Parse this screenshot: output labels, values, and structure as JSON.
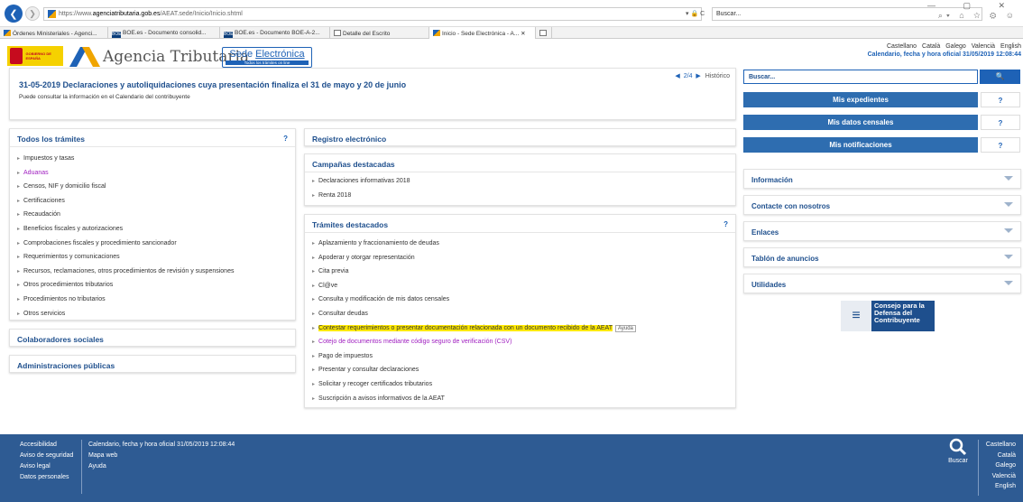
{
  "browser": {
    "url_scheme": "https://www.",
    "url_host": "agenciatributaria.gob.es",
    "url_path": "/AEAT.sede/Inicio/Inicio.shtml",
    "url_tools": "▾ 🔒 C",
    "search_placeholder": "Buscar...",
    "window_controls": "— ▢ ✕",
    "chrome_icons": "⌕▾ ⌂ ☆ ⚙ ☺",
    "tabs": [
      {
        "label": "Órdenes Ministeriales - Agenci...",
        "icon": "aeat"
      },
      {
        "label": "BOE.es - Documento consolid...",
        "icon": "boe"
      },
      {
        "label": "BOE.es - Documento BOE-A-2...",
        "icon": "boe"
      },
      {
        "label": "Detalle del Escrito",
        "icon": "doc"
      },
      {
        "label": "Inicio - Sede Electrónica - A... ✕",
        "icon": "aeat"
      },
      {
        "label": "",
        "icon": "doc"
      }
    ],
    "boe_icon_text": "BOE"
  },
  "header": {
    "gobierno": "GOBIERNO DE ESPAÑA",
    "brand": "Agencia Tributaria",
    "sede_title_a": "Sede ",
    "sede_title_b": "Electrónica",
    "sede_sub": "Todos los trámites on line",
    "languages": [
      "Castellano",
      "Català",
      "Galego",
      "Valencià",
      "English"
    ],
    "date": "Calendario, fecha y hora oficial 31/05/2019 12:08:44"
  },
  "news": {
    "title": "31-05-2019  Declaraciones y autoliquidaciones cuya presentación finaliza el 31 de mayo y 20 de junio",
    "subtitle": "Puede consultar la información en el Calendario del contribuyente",
    "pager": "2/4",
    "prev": "◀",
    "next": "▶",
    "historico": "Histórico"
  },
  "todos": {
    "title": "Todos los trámites",
    "help": "?",
    "items": [
      "Impuestos y tasas",
      "Aduanas",
      "Censos, NIF y domicilio fiscal",
      "Certificaciones",
      "Recaudación",
      "Beneficios fiscales y autorizaciones",
      "Comprobaciones fiscales y procedimiento sancionador",
      "Requerimientos y comunicaciones",
      "Recursos, reclamaciones, otros procedimientos de revisión y suspensiones",
      "Otros procedimientos tributarios",
      "Procedimientos no tributarios",
      "Otros servicios"
    ]
  },
  "colaboradores": {
    "title": "Colaboradores sociales"
  },
  "administraciones": {
    "title": "Administraciones públicas"
  },
  "registro": {
    "title": "Registro electrónico"
  },
  "campanas": {
    "title": "Campañas destacadas",
    "items": [
      "Declaraciones informativas 2018",
      "Renta 2018"
    ]
  },
  "tramites": {
    "title": "Trámites destacados",
    "help": "?",
    "items": [
      "Aplazamiento y fraccionamiento de deudas",
      "Apoderar y otorgar representación",
      "Cita previa",
      "Cl@ve",
      "Consulta y modificación de mis datos censales",
      "Consultar deudas",
      "Contestar requerimientos o presentar documentación relacionada con un documento recibido de la AEAT",
      "Cotejo de documentos mediante código seguro de verificación (CSV)",
      "Pago de impuestos",
      "Presentar y consultar declaraciones",
      "Solicitar y recoger certificados tributarios",
      "Suscripción a avisos informativos de la AEAT"
    ],
    "ayuda": "Ayuda"
  },
  "right": {
    "search_placeholder": "Buscar...",
    "search_icon": "🔍",
    "buttons": [
      "Mis expedientes",
      "Mis datos censales",
      "Mis notificaciones"
    ],
    "help": "?",
    "accordions": [
      "Información",
      "Contacte con nosotros",
      "Enlaces",
      "Tablón de anuncios",
      "Utilidades"
    ],
    "consejo": "Consejo para la Defensa del Contribuyente"
  },
  "footer": {
    "col1": [
      "Accesibilidad",
      "Aviso de seguridad",
      "Aviso legal",
      "Datos personales"
    ],
    "col2": [
      "Calendario, fecha y hora oficial 31/05/2019 12:08:44",
      "Mapa web",
      "Ayuda"
    ],
    "search_label": "Buscar",
    "languages": [
      "Castellano",
      "Català",
      "Galego",
      "Valencià",
      "English"
    ]
  },
  "colors": {
    "accent": "#1e62b6",
    "title_blue": "#1e4f8d",
    "footer": "#2e5b93",
    "highlight": "#ffe900",
    "visited": "#a020c0"
  }
}
